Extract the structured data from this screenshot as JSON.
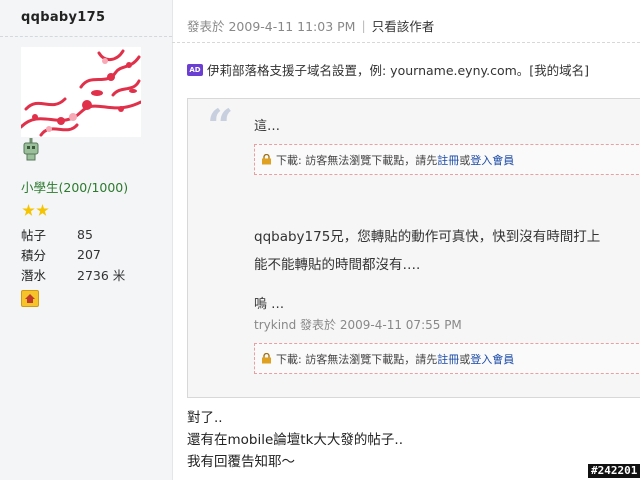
{
  "sidebar": {
    "username": "qqbaby175",
    "rank": "小學生(200/1000)",
    "stats": [
      {
        "label": "帖子",
        "value": "85"
      },
      {
        "label": "積分",
        "value": "207"
      },
      {
        "label": "潛水",
        "value": "2736 米"
      }
    ],
    "star_count": 2
  },
  "post": {
    "posted_at": "發表於 2009-4-11 11:03 PM",
    "separator": "|",
    "only_author": "只看該作者"
  },
  "ad": {
    "badge": "AD",
    "text": "伊莉部落格支援子域名設置，例: yourname.eyny.com。[我的域名]"
  },
  "quote": {
    "line1": "這…",
    "attachment": {
      "prefix": "下載: 訪客無法瀏覽下載點，請先",
      "register": "註冊",
      "or": "或",
      "login": "登入會員"
    },
    "para_line1": "qqbaby175兄，您轉貼的動作可真快，快到沒有時間打上",
    "para_line2": "能不能轉貼的時間都沒有….",
    "para2": "嗚 …",
    "signature": "trykind 發表於 2009-4-11 07:55 PM"
  },
  "reply": {
    "line1": "對了..",
    "line2": "還有在mobile論壇tk大大發的帖子..",
    "line3": "我有回覆告知耶～"
  },
  "post_id": "#242201",
  "colors": {
    "rank_green": "#2d7a2d",
    "link_blue": "#1a4aa6",
    "star_gold": "#f5c400",
    "sidebar_bg": "#f3f5f7"
  }
}
